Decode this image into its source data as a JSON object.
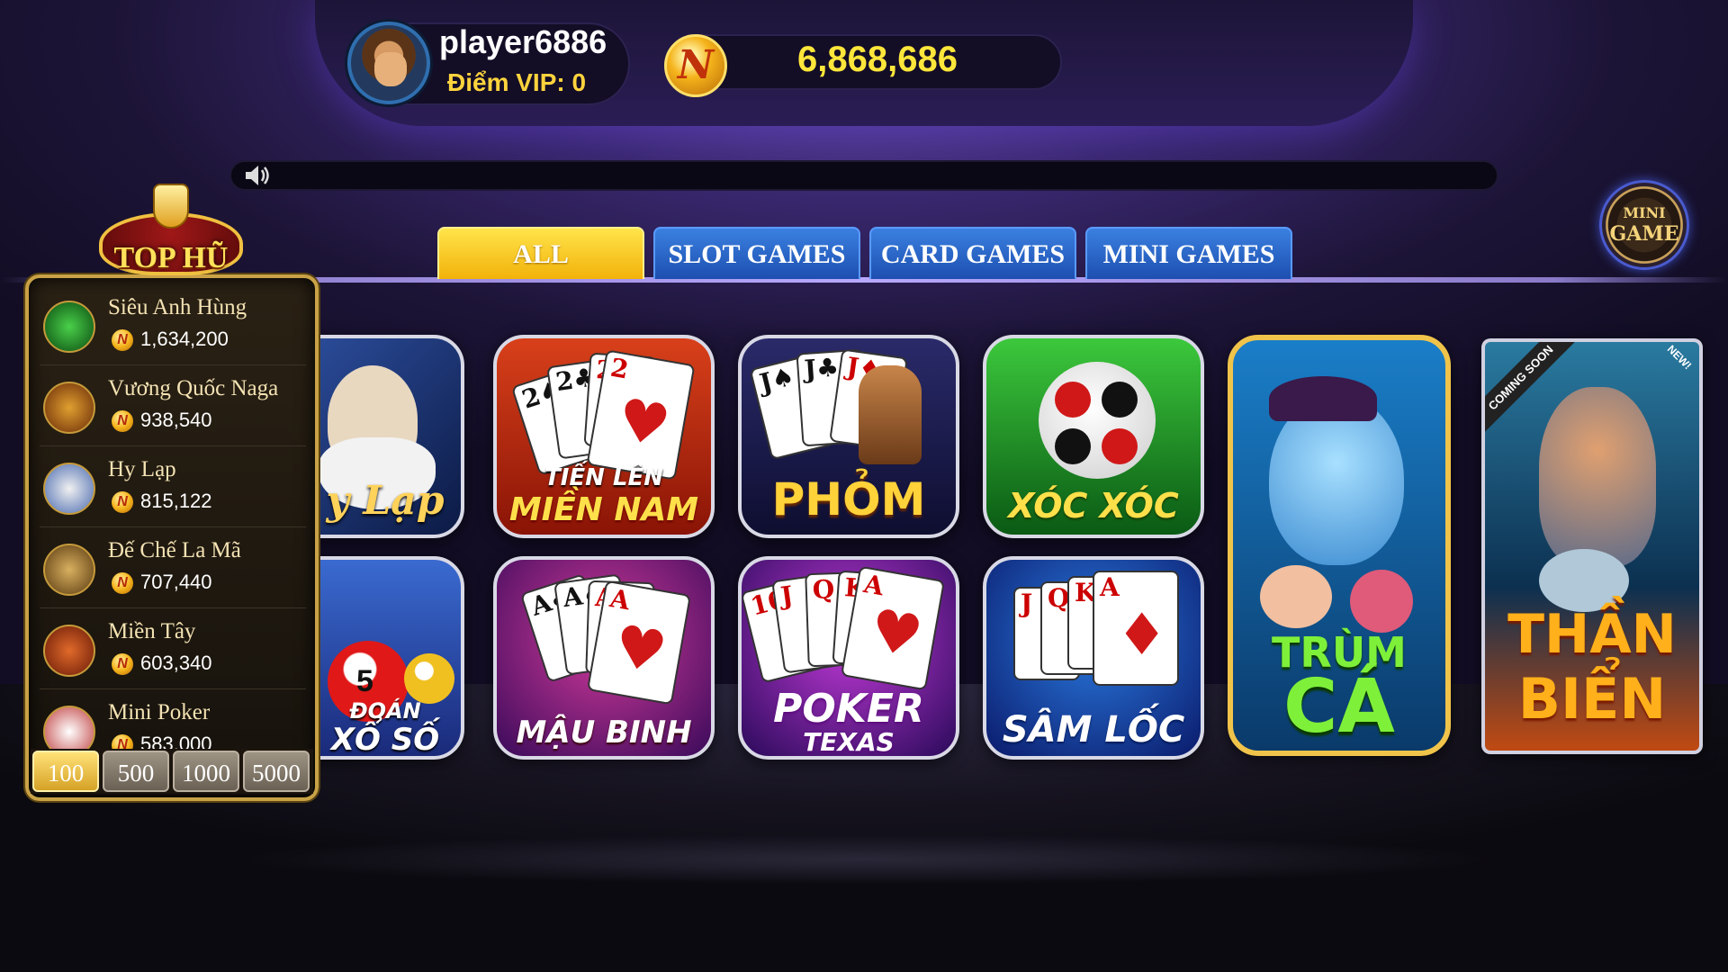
{
  "player": {
    "username": "player6886",
    "vip_label": "Điểm VIP: 0",
    "balance": "6,868,686",
    "coin_letter": "N"
  },
  "tabs": [
    {
      "label": "ALL",
      "active": true
    },
    {
      "label": "SLOT GAMES",
      "active": false
    },
    {
      "label": "CARD GAMES",
      "active": false
    },
    {
      "label": "MINI GAMES",
      "active": false
    }
  ],
  "mini_game": {
    "line1": "MINI",
    "line2": "GAME"
  },
  "jackpot": {
    "title": "TOP HŨ",
    "items": [
      {
        "name": "Siêu Anh Hùng",
        "value": "1,634,200"
      },
      {
        "name": "Vương Quốc Naga",
        "value": "938,540"
      },
      {
        "name": "Hy Lạp",
        "value": "815,122"
      },
      {
        "name": "Đế Chế La Mã",
        "value": "707,440"
      },
      {
        "name": "Miền Tây",
        "value": "603,340"
      },
      {
        "name": "Mini Poker",
        "value": "583,000"
      }
    ],
    "bets": [
      "100",
      "500",
      "1000",
      "5000"
    ],
    "active_bet": "100"
  },
  "games": {
    "hy_lap": "y Lạp",
    "tien_len_1": "TIẾN LÊN",
    "tien_len_2": "MIỀN NAM",
    "phom": "PHỎM",
    "xoc_xoc": "XÓC XÓC",
    "trum_ca_1": "TRÙM",
    "trum_ca_2": "CÁ",
    "than_bien_1": "THẦN",
    "than_bien_2": "BIỂN",
    "coming_soon": "COMING SOON",
    "new_badge": "NEW!",
    "doan_xo_so_1": "ĐOÁN",
    "doan_xo_so_2": "XỔ SỐ",
    "mau_binh": "MẬU BINH",
    "poker_1": "POKER",
    "poker_2": "TEXAS",
    "sam_loc": "SÂM LỐC"
  },
  "colors": {
    "gold": "#ffe63a",
    "tab_blue": "#1d4fb0",
    "tab_active": "#f2b20a"
  }
}
